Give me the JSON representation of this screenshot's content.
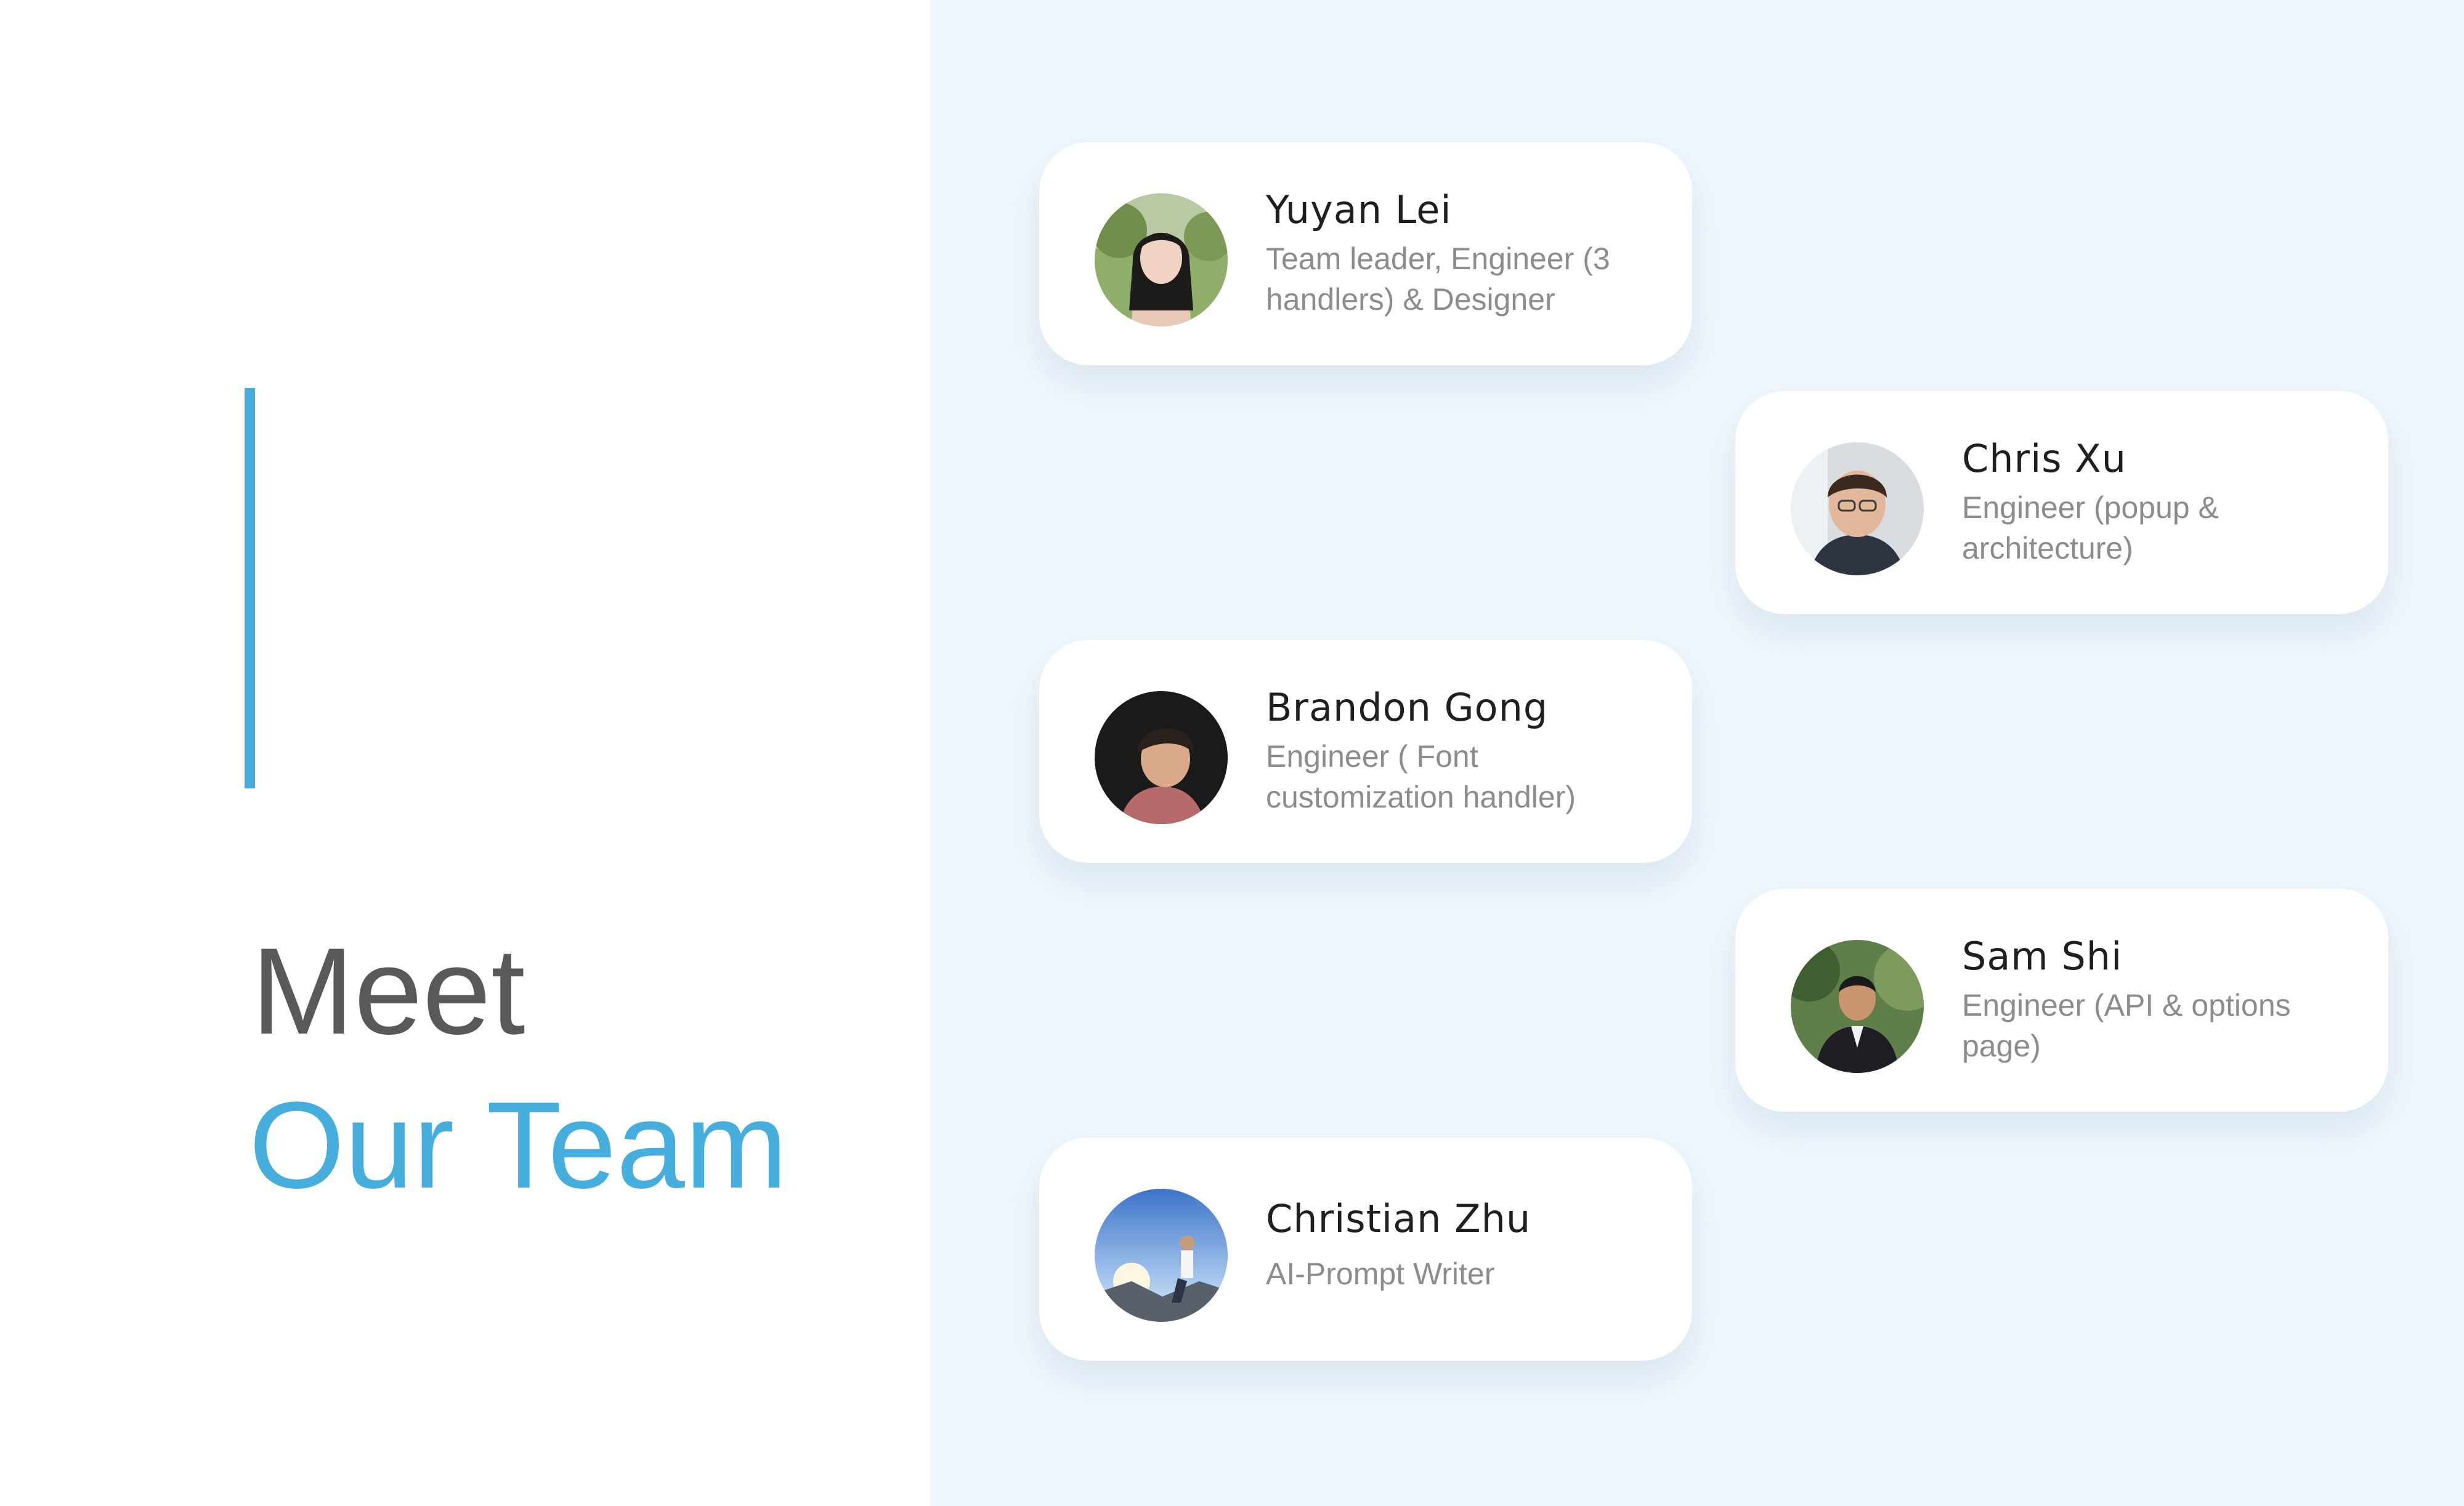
{
  "heading": {
    "line1": "Meet",
    "line2": "Our Team"
  },
  "colors": {
    "accent": "#45aedc",
    "heading_gray": "#595959",
    "panel_background": "#eff7fd",
    "card_background": "#ffffff",
    "role_text": "#8c8c8c"
  },
  "team": [
    {
      "name": "Yuyan  Lei",
      "role": "Team leader, Engineer (3 handlers) & Designer",
      "avatar_icon": "person-photo-icon"
    },
    {
      "name": "Chris  Xu",
      "role": "Engineer (popup & architecture)",
      "avatar_icon": "person-photo-icon"
    },
    {
      "name": "Brandon  Gong",
      "role": "Engineer ( Font customization handler)",
      "avatar_icon": "person-photo-icon"
    },
    {
      "name": "Sam  Shi",
      "role": "Engineer (API & options page)",
      "avatar_icon": "person-photo-icon"
    },
    {
      "name": "Christian  Zhu",
      "role": "AI-Prompt Writer",
      "avatar_icon": "person-photo-icon"
    }
  ]
}
